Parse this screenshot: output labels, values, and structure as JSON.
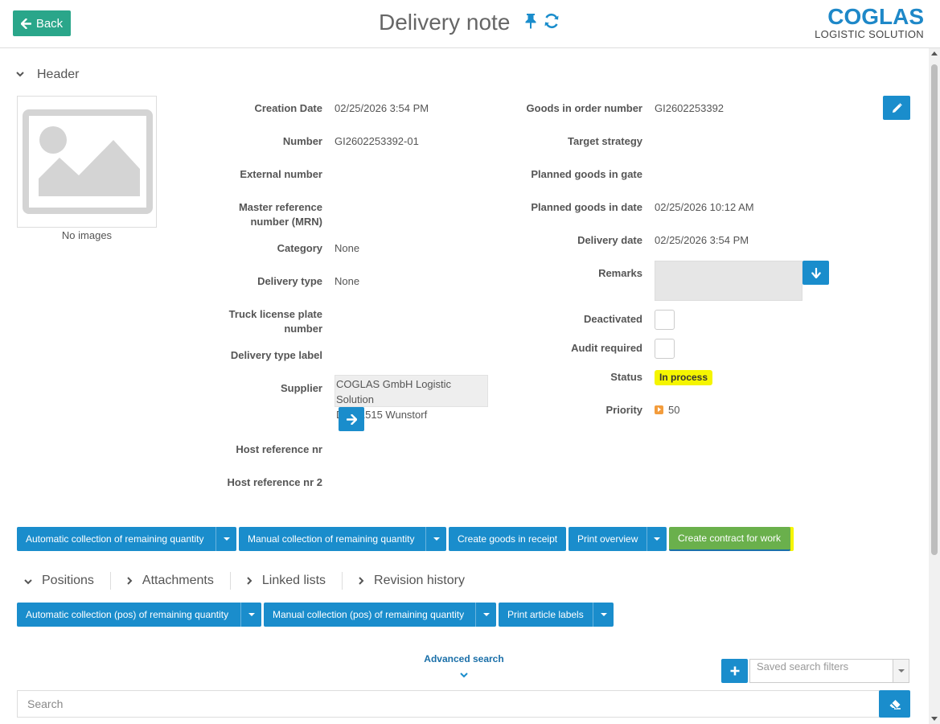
{
  "topbar": {
    "back_label": "Back",
    "title": "Delivery note",
    "logo_main": "COGLAS",
    "logo_sub": "LOGISTIC SOLUTION"
  },
  "header_section": {
    "title": "Header",
    "no_images": "No images"
  },
  "left_fields": [
    {
      "label": "Creation Date",
      "value": "02/25/2026 3:54 PM"
    },
    {
      "label": "Number",
      "value": "GI2602253392-01"
    },
    {
      "label": "External number",
      "value": ""
    },
    {
      "label": "Master reference number (MRN)",
      "value": ""
    },
    {
      "label": "Category",
      "value": "None"
    },
    {
      "label": "Delivery type",
      "value": "None"
    },
    {
      "label": "Truck license plate number",
      "value": ""
    },
    {
      "label": "Delivery type label",
      "value": ""
    },
    {
      "label": "Supplier",
      "value_line1": "COGLAS GmbH Logistic Solution",
      "value_line2": "DE 31515 Wunstorf"
    },
    {
      "label": "Host reference nr",
      "value": ""
    },
    {
      "label": "Host reference nr 2",
      "value": ""
    }
  ],
  "right_fields": [
    {
      "label": "Goods in order number",
      "value": "GI2602253392"
    },
    {
      "label": "Target strategy",
      "value": ""
    },
    {
      "label": "Planned goods in gate",
      "value": ""
    },
    {
      "label": "Planned goods in date",
      "value": "02/25/2026 10:12 AM"
    },
    {
      "label": "Delivery date",
      "value": "02/25/2026 3:54 PM"
    },
    {
      "label": "Remarks",
      "value": ""
    },
    {
      "label": "Deactivated",
      "value": false
    },
    {
      "label": "Audit required",
      "value": false
    },
    {
      "label": "Status",
      "value": "In process"
    },
    {
      "label": "Priority",
      "value": "50"
    }
  ],
  "actions": [
    {
      "label": "Automatic collection of remaining quantity",
      "dropdown": true
    },
    {
      "label": "Manual collection of remaining quantity",
      "dropdown": true
    },
    {
      "label": "Create goods in receipt",
      "dropdown": false
    },
    {
      "label": "Print overview",
      "dropdown": true
    },
    {
      "label": "Create contract for work",
      "dropdown": false
    }
  ],
  "tabs": [
    "Positions",
    "Attachments",
    "Linked lists",
    "Revision history"
  ],
  "position_actions": [
    {
      "label": "Automatic collection (pos) of remaining quantity"
    },
    {
      "label": "Manual collection (pos) of remaining quantity"
    },
    {
      "label": "Print article labels"
    }
  ],
  "search": {
    "advanced_label": "Advanced search",
    "saved_filters_placeholder": "Saved search filters",
    "placeholder": "Search"
  },
  "colors": {
    "primary": "#1a8dcc",
    "back_button": "#2aa68a",
    "status_badge": "#f5f500",
    "contract_button": "#6ab04c",
    "priority_icon": "#f39c3c",
    "logo": "#1e88c8"
  },
  "icons": [
    "arrow-left-icon",
    "pin-icon",
    "refresh-icon",
    "pencil-icon",
    "arrow-down-icon",
    "arrow-right-icon",
    "plus-icon",
    "eraser-icon",
    "chevron-down-icon",
    "image-placeholder-icon"
  ]
}
